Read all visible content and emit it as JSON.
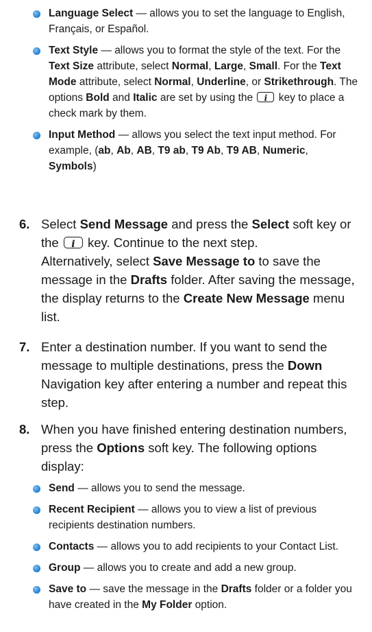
{
  "bullets_top": [
    {
      "term": "Language Select",
      "rest": " — allows you to set the language to English, Français, or Español."
    },
    {
      "term": "Text Style",
      "parts": [
        " — allows you to format the style of the text. For the ",
        "Text Size",
        " attribute, select ",
        "Normal",
        ", ",
        "Large",
        ", ",
        "Small",
        ". For the ",
        "Text Mode",
        " attribute, select ",
        "Normal",
        ", ",
        "Underline",
        ", or ",
        "Strikethrough",
        ". The options ",
        "Bold",
        " and ",
        "Italic",
        " are set by using the ",
        " key to place a check mark by them."
      ]
    },
    {
      "term": "Input Method",
      "parts": [
        " — allows you select the text input method. For example, (",
        "ab",
        ", ",
        "Ab",
        ", ",
        "AB",
        ", ",
        "T9 ab",
        ", ",
        "T9 Ab",
        ", ",
        "T9 AB",
        ", ",
        "Numeric",
        ", ",
        "Symbols",
        ")"
      ]
    }
  ],
  "step6": {
    "num": "6.",
    "parts": [
      "Select ",
      "Send Message",
      " and press the ",
      "Select",
      " soft key or the ",
      " key. Continue to the next step.",
      "Alternatively, select ",
      "Save Message to",
      " to save the message in the ",
      "Drafts",
      " folder. After saving the message, the display returns to the ",
      "Create New Message",
      " menu list."
    ]
  },
  "step7": {
    "num": "7.",
    "parts": [
      "Enter a destination number. If you want to send the message to multiple destinations, press the ",
      "Down",
      " Navigation key after entering a number and repeat this step."
    ]
  },
  "step8": {
    "num": "8.",
    "parts": [
      "When you have finished entering destination numbers, press the ",
      "Options",
      " soft key. The following options display:"
    ]
  },
  "bullets_bottom": [
    {
      "term": "Send",
      "rest": " — allows you to send the message."
    },
    {
      "term": "Recent Recipient",
      "rest": " — allows you to view a list of previous recipients destination numbers."
    },
    {
      "term": "Contacts",
      "rest": " — allows you to add recipients to your Contact List."
    },
    {
      "term": "Group",
      "rest": " — allows you to create and add a new group."
    },
    {
      "term": "Save to",
      "parts": [
        " — save the message in the ",
        "Drafts",
        " folder or a folder you have created in the ",
        "My Folder",
        " option."
      ]
    }
  ],
  "colors": {
    "bullet": "#1f7cd0",
    "text": "#1a1a1a"
  },
  "icons": {
    "key": "ok-key-icon",
    "bullet": "bullet-dot-icon"
  }
}
